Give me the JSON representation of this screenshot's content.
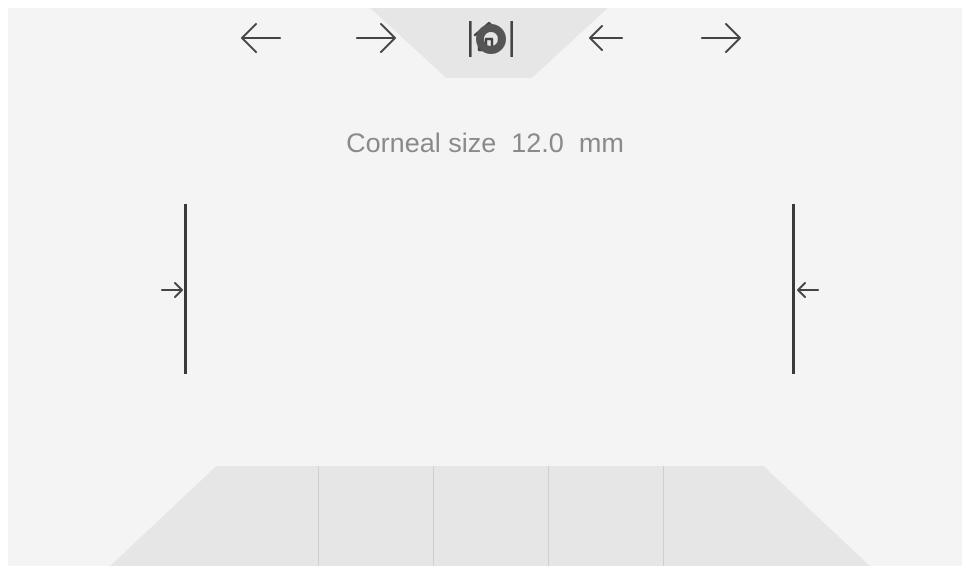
{
  "header": {
    "home_icon": "home-icon"
  },
  "measurement": {
    "label": "Corneal size",
    "value": "12.0",
    "unit": "mm"
  },
  "markers": {
    "left_arrow_icon": "arrow-right-icon",
    "right_arrow_icon": "arrow-left-icon"
  },
  "controls": [
    {
      "icon": "arrow-left-icon",
      "target": "left-marker"
    },
    {
      "icon": "arrow-right-icon",
      "target": "left-marker"
    },
    {
      "icon": "center-circle-icon"
    },
    {
      "icon": "arrow-left-icon",
      "target": "right-marker"
    },
    {
      "icon": "arrow-right-icon",
      "target": "right-marker"
    }
  ],
  "colors": {
    "background": "#f4f4f4",
    "panel": "#e6e6e6",
    "text": "#8a8a8a",
    "marker": "#3a3a3a"
  }
}
